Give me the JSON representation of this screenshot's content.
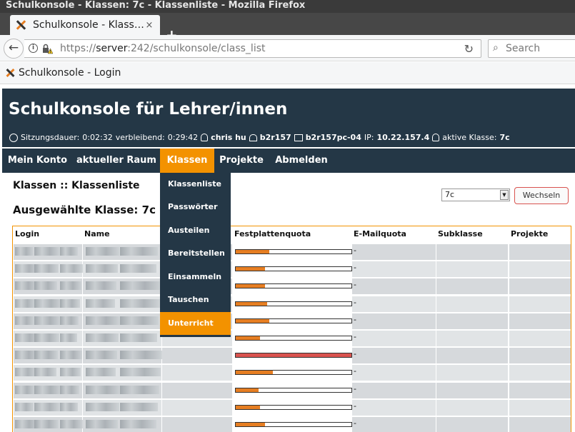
{
  "window": {
    "title": "Schulkonsole - Klassen: 7c - Klassenliste - Mozilla Firefox"
  },
  "tab": {
    "title": "Schulkonsole - Klass…",
    "close": "×",
    "new_tab": "+"
  },
  "nav": {
    "url_scheme": "https://",
    "url_host": "server",
    "url_rest": ":242/schulkonsole/class_list",
    "search_placeholder": "Search"
  },
  "bookmarks": {
    "item": "Schulkonsole - Login"
  },
  "header": {
    "title": "Schulkonsole für Lehrer/innen",
    "session_label": "Sitzungsdauer:",
    "session_time": "0:02:32",
    "remaining_label": "verbleibend:",
    "remaining_time": "0:29:42",
    "user": "chris hu",
    "room": "b2r157",
    "pc": "b2r157pc-04",
    "ip_label": "IP:",
    "ip": "10.22.157.4",
    "class_label": "aktive Klasse:",
    "class": "7c"
  },
  "menu": [
    {
      "label": "Mein Konto"
    },
    {
      "label": "aktueller Raum"
    },
    {
      "label": "Klassen"
    },
    {
      "label": "Projekte"
    },
    {
      "label": "Abmelden"
    }
  ],
  "dropdown": [
    {
      "label": "Klassenliste"
    },
    {
      "label": "Passwörter"
    },
    {
      "label": "Austeilen"
    },
    {
      "label": "Bereitstellen"
    },
    {
      "label": "Einsammeln"
    },
    {
      "label": "Tauschen"
    },
    {
      "label": "Unterricht"
    }
  ],
  "main": {
    "heading": "Klassen :: Klassenliste",
    "selected_heading": "Ausgewählte Klasse: 7c",
    "select_value": "7c",
    "select_arrow": "▼",
    "switch_button": "Wechseln"
  },
  "table": {
    "columns": [
      "Login",
      "Name",
      "",
      "Festplattenquota",
      "E-Mailquota",
      "Subklasse",
      "Projekte"
    ],
    "rows": [
      {
        "quota": 0.29,
        "mail": "-"
      },
      {
        "quota": 0.25,
        "mail": "-"
      },
      {
        "quota": 0.25,
        "mail": "-"
      },
      {
        "quota": 0.27,
        "mail": "-"
      },
      {
        "quota": 0.29,
        "mail": "-"
      },
      {
        "quota": 0.21,
        "mail": "-"
      },
      {
        "quota": 1.0,
        "mail": "-"
      },
      {
        "quota": 0.32,
        "mail": "-"
      },
      {
        "quota": 0.2,
        "mail": "-"
      },
      {
        "quota": 0.21,
        "mail": "-"
      },
      {
        "quota": 0.25,
        "mail": "-"
      }
    ]
  },
  "colors": {
    "header": "#243746",
    "accent": "#f39200",
    "quota_fill": "#e67e22",
    "quota_full": "#d9534f"
  }
}
